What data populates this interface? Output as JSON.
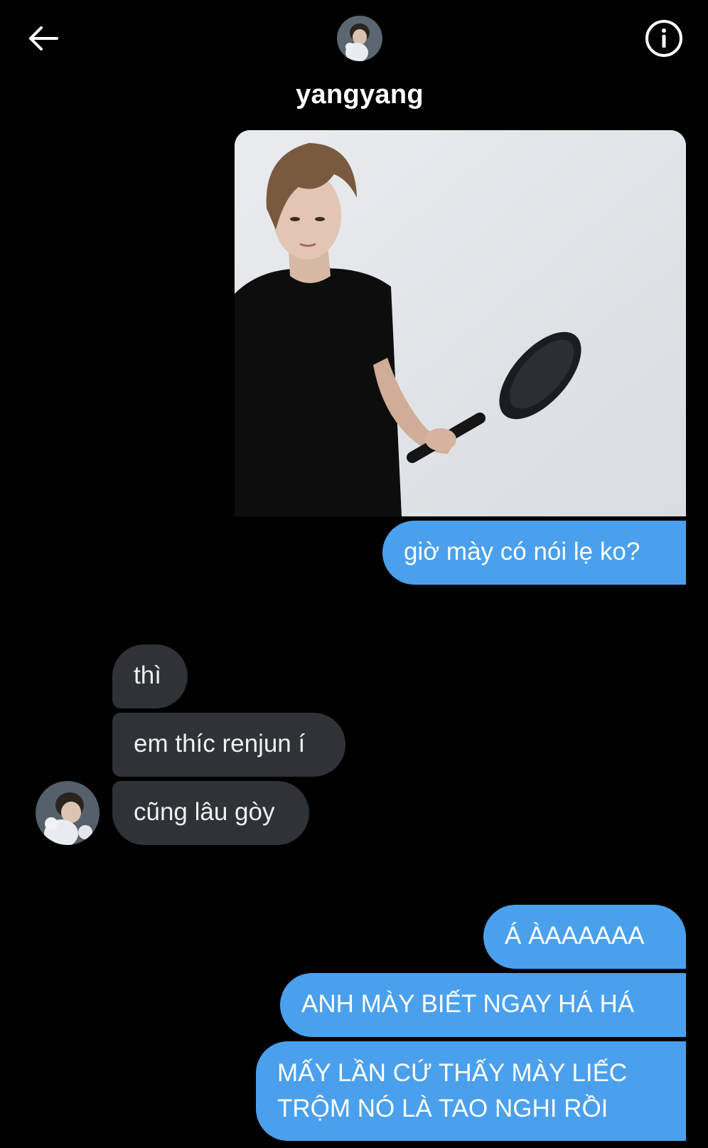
{
  "header": {
    "back_icon": "arrow-left-icon",
    "info_icon": "info-circle-icon",
    "username": "yangyang"
  },
  "messages": [
    {
      "direction": "sent",
      "type": "image",
      "image_icon": "photo-person-holding-frying-pan"
    },
    {
      "direction": "sent",
      "type": "text",
      "text": "giờ mày có nói lẹ ko?"
    },
    {
      "direction": "received",
      "type": "text",
      "text": "thì"
    },
    {
      "direction": "received",
      "type": "text",
      "text": "em thíc renjun í"
    },
    {
      "direction": "received",
      "type": "text",
      "text": "cũng lâu gòy"
    },
    {
      "direction": "sent",
      "type": "text",
      "text": "Á ÀAAAAAA"
    },
    {
      "direction": "sent",
      "type": "text",
      "text": "ANH MÀY BIẾT NGAY HÁ HÁ"
    },
    {
      "direction": "sent",
      "type": "text",
      "text": "MẤY LẦN CỨ THẤY MÀY LIẾC TRỘM NÓ LÀ TAO NGHI RỒI"
    }
  ],
  "colors": {
    "background": "#000000",
    "sent_bubble": "#4aa0ec",
    "received_bubble": "#2f3236",
    "text": "#ffffff"
  }
}
